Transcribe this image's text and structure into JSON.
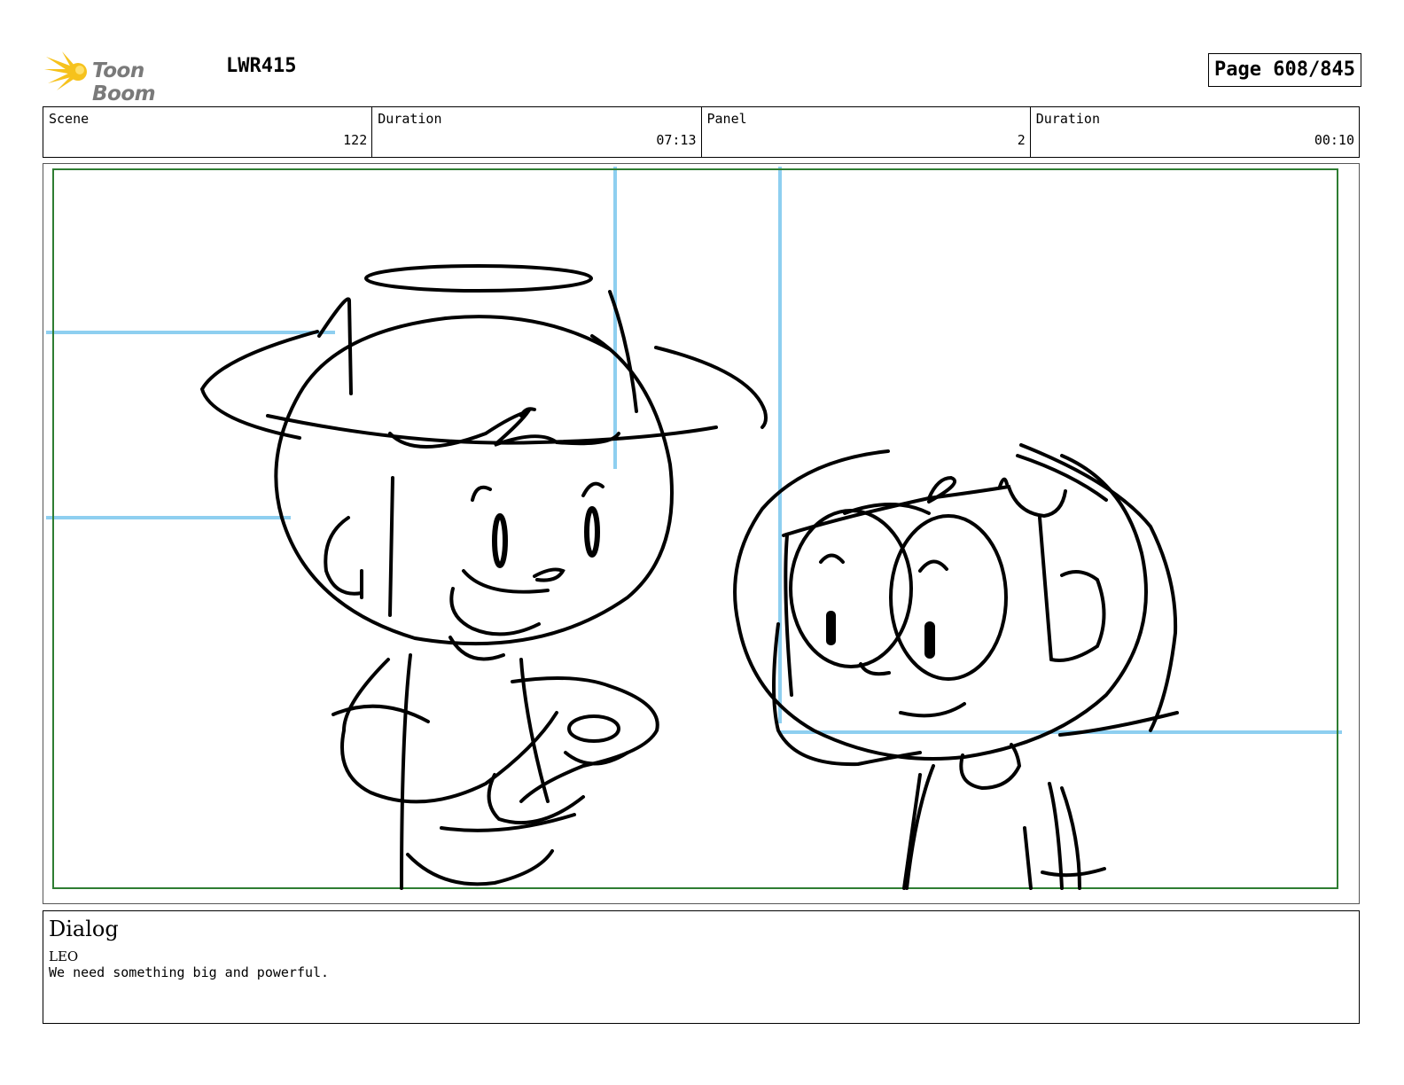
{
  "header": {
    "logo_text": "Toon Boom",
    "project_code": "LWR415",
    "page_label": "Page 608/845"
  },
  "info": {
    "scene_label": "Scene",
    "scene_value": "122",
    "scene_duration_label": "Duration",
    "scene_duration_value": "07:13",
    "panel_label": "Panel",
    "panel_value": "2",
    "panel_duration_label": "Duration",
    "panel_duration_value": "00:10"
  },
  "dialog": {
    "title": "Dialog",
    "speaker": "LEO",
    "line": "We need something big and powerful."
  },
  "colors": {
    "safe_frame": "#2e7d32",
    "guide_lines": "#8ecff0",
    "logo_sun": "#f6c21c"
  }
}
